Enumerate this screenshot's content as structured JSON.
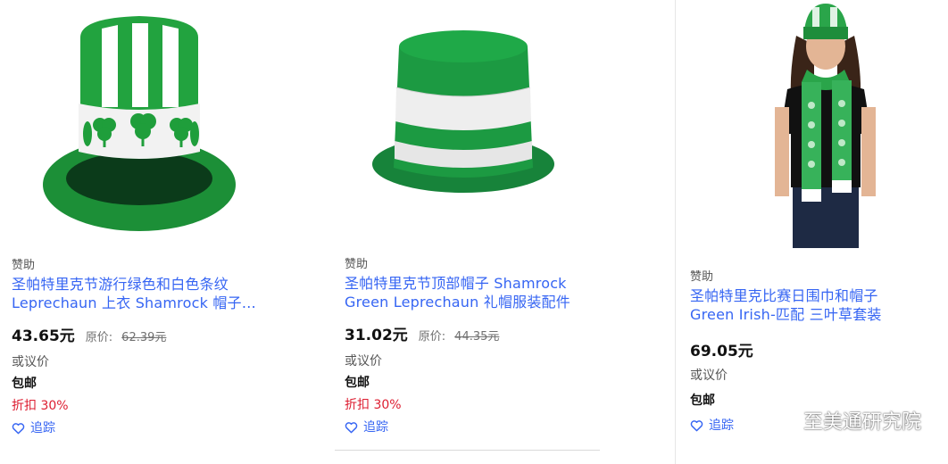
{
  "products": [
    {
      "sponsor": "赞助",
      "title_line1": "圣帕特里克节游行绿色和白色条纹",
      "title_line2": "Leprechaun 上衣 Shamrock 帽子…",
      "price": "43.65元",
      "original_label": "原价:",
      "original_price": "62.39元",
      "negotiable": "或议价",
      "shipping": "包邮",
      "discount": "折扣 30%",
      "track_label": "追踪",
      "image_icon": "shamrock-top-hat-image"
    },
    {
      "sponsor": "赞助",
      "title_line1": "圣帕特里克节顶部帽子 Shamrock",
      "title_line2": "Green Leprechaun 礼帽服装配件",
      "price": "31.02元",
      "original_label": "原价:",
      "original_price": "44.35元",
      "negotiable": "或议价",
      "shipping": "包邮",
      "discount": "折扣 30%",
      "track_label": "追踪",
      "image_icon": "striped-top-hat-image"
    },
    {
      "sponsor": "赞助",
      "title_line1": "圣帕特里克比赛日围巾和帽子",
      "title_line2": "Green Irish-匹配 三叶草套装",
      "price": "69.05元",
      "negotiable": "或议价",
      "shipping": "包邮",
      "track_label": "追踪",
      "image_icon": "scarf-and-beanie-model-image"
    }
  ],
  "watermark": {
    "text": "至美通研究院",
    "icon": "wechat-icon"
  },
  "colors": {
    "link": "#3665f3",
    "discount": "#dd1e31",
    "hat_green": "#1a9a3c"
  }
}
